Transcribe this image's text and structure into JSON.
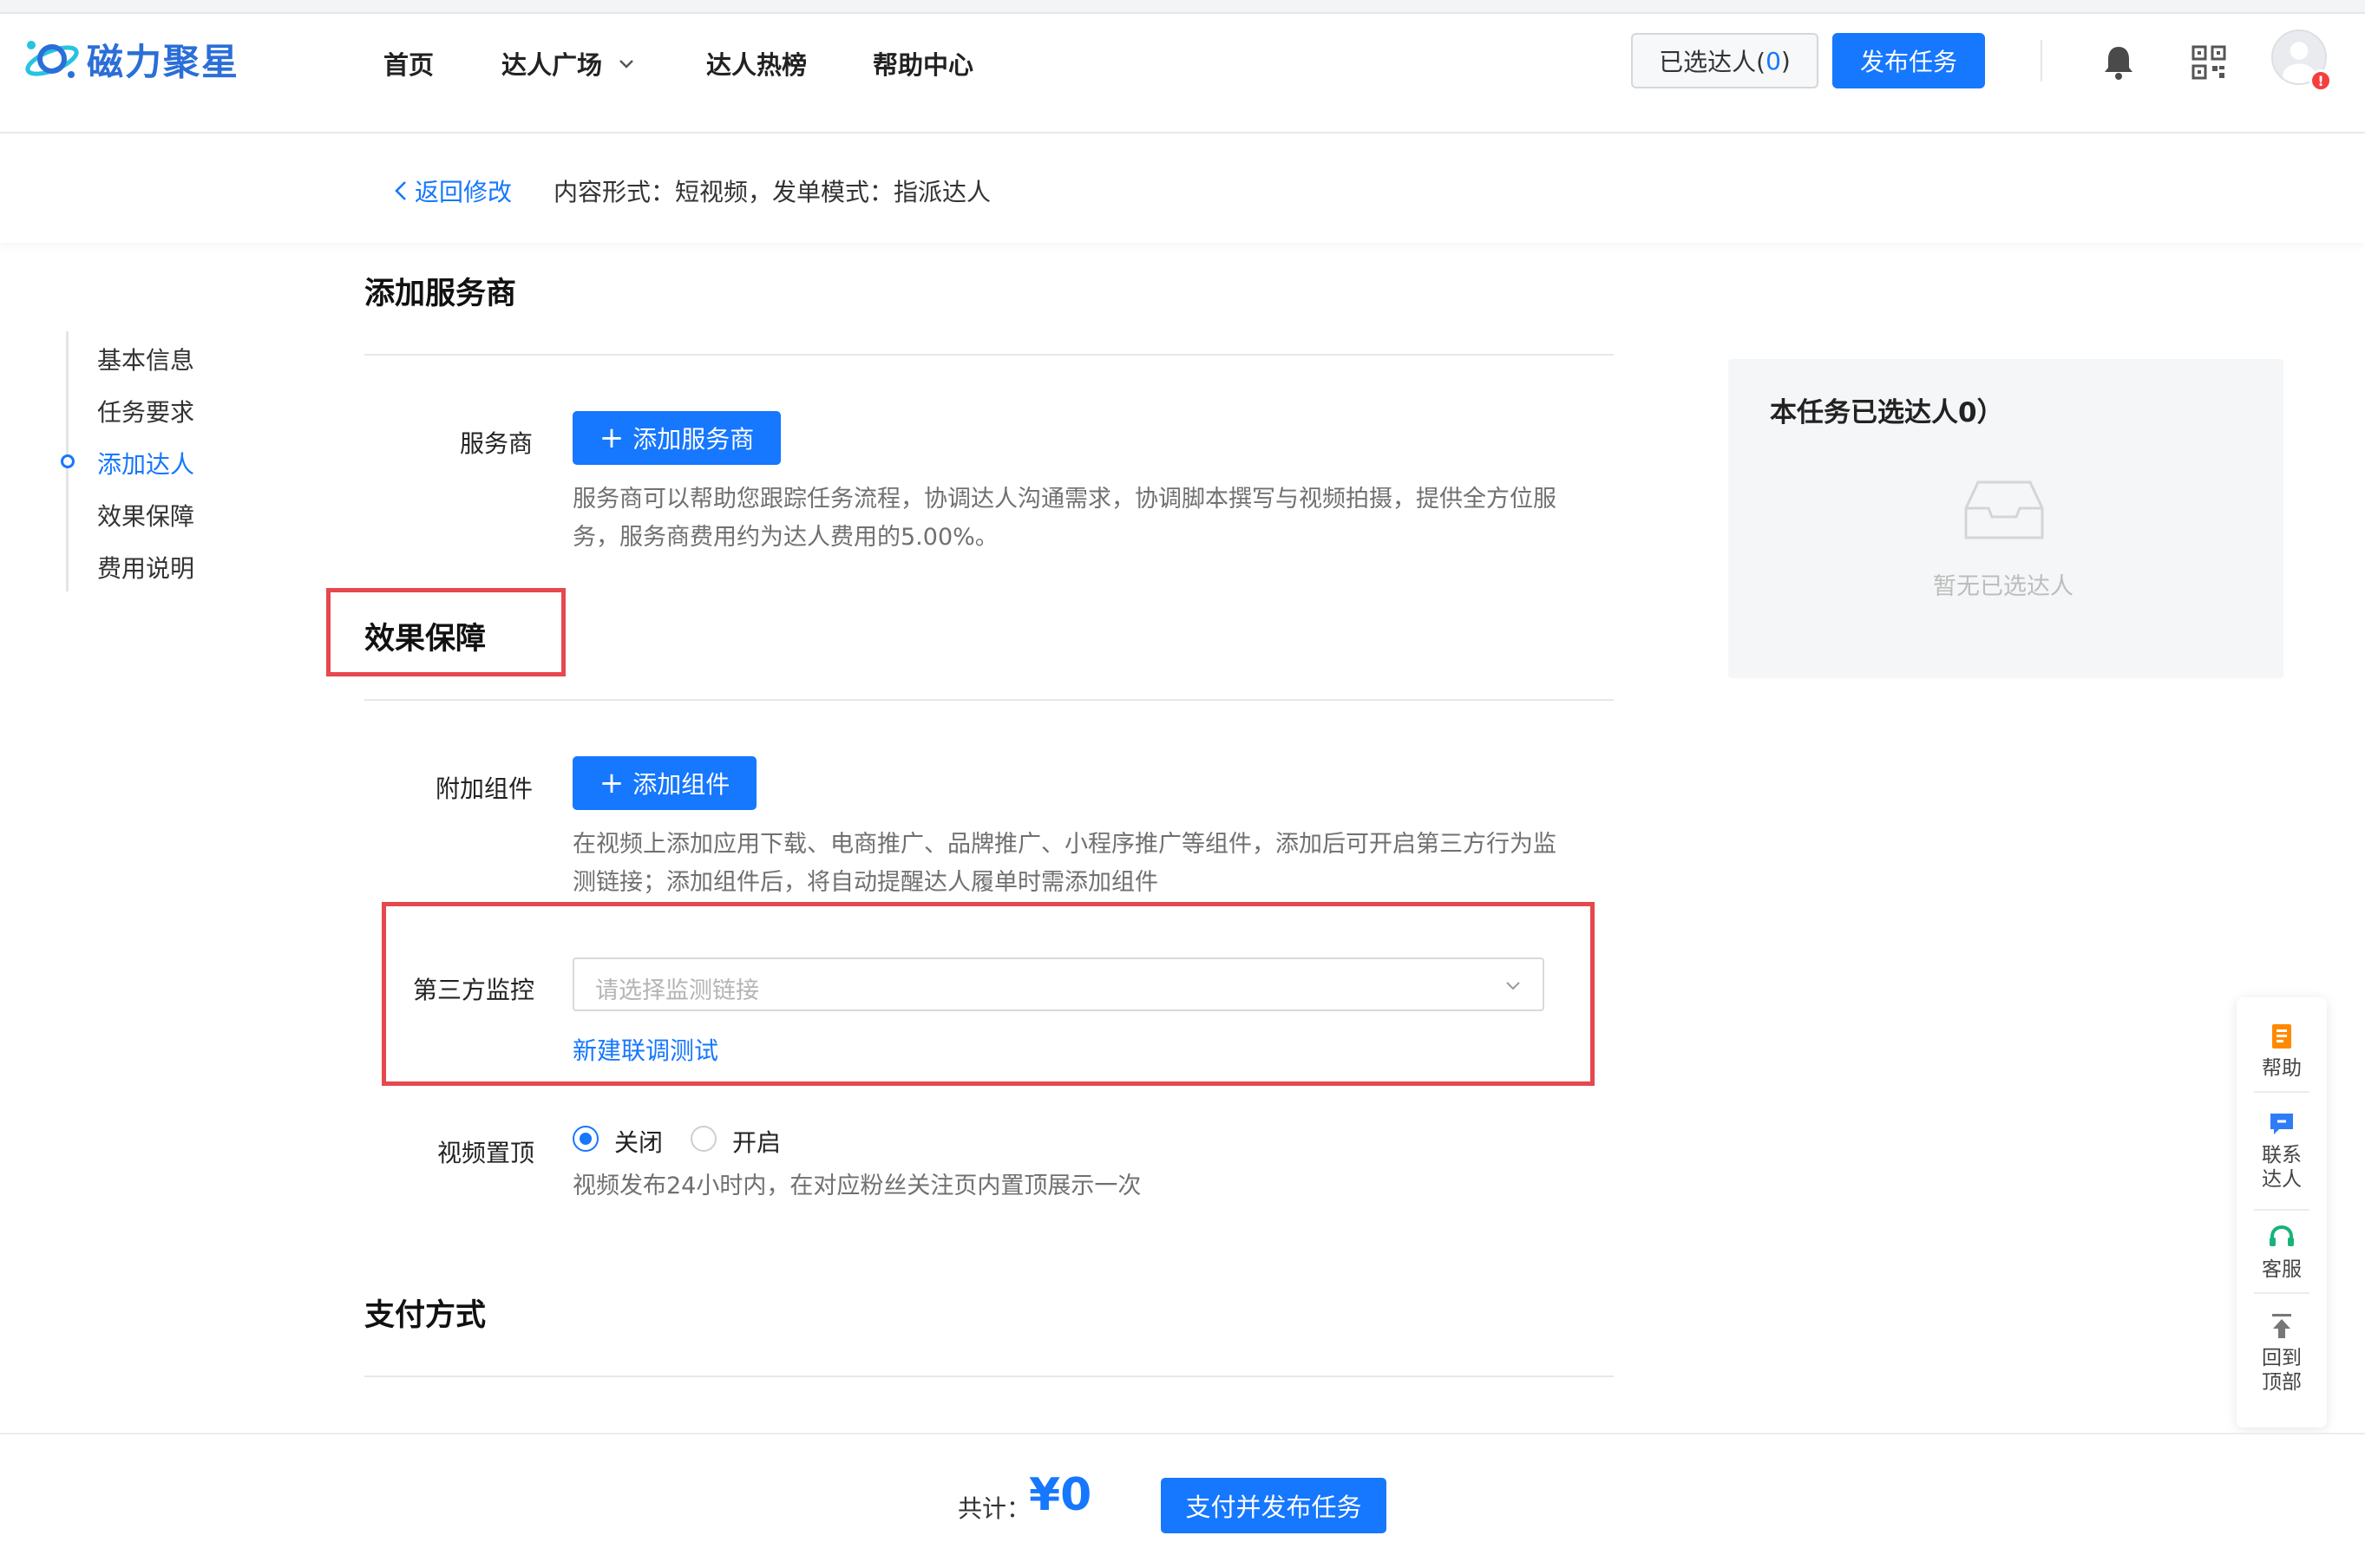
{
  "header": {
    "logo_text": "磁力聚星",
    "nav": [
      {
        "label": "首页"
      },
      {
        "label": "达人广场"
      },
      {
        "label": "达人热榜"
      },
      {
        "label": "帮助中心"
      }
    ],
    "selected_prefix": "已选达人(",
    "selected_count": "0",
    "selected_suffix": ")",
    "publish_label": "发布任务"
  },
  "subbar": {
    "back_label": "返回修改",
    "content_info": "内容形式：短视频，发单模式：指派达人"
  },
  "sidebar": {
    "items": [
      {
        "label": "基本信息"
      },
      {
        "label": "任务要求"
      },
      {
        "label": "添加达人"
      },
      {
        "label": "效果保障"
      },
      {
        "label": "费用说明"
      }
    ],
    "active_index": 2
  },
  "main": {
    "section_service": {
      "title": "添加服务商",
      "label": "服务商",
      "button": "添加服务商",
      "description": "服务商可以帮助您跟踪任务流程，协调达人沟通需求，协调脚本撰写与视频拍摄，提供全方位服务，服务商费用约为达人费用的5.00%。"
    },
    "section_effect": {
      "title": "效果保障",
      "component_label": "附加组件",
      "component_button": "添加组件",
      "component_description": "在视频上添加应用下载、电商推广、品牌推广、小程序推广等组件，添加后可开启第三方行为监测链接；添加组件后，将自动提醒达人履单时需添加组件",
      "monitor_label": "第三方监控",
      "monitor_placeholder": "请选择监测链接",
      "monitor_link": "新建联调测试",
      "pin_label": "视频置顶",
      "pin_options": [
        {
          "label": "关闭",
          "selected": true
        },
        {
          "label": "开启",
          "selected": false
        }
      ],
      "pin_description": "视频发布24小时内，在对应粉丝关注页内置顶展示一次"
    },
    "section_payment": {
      "title": "支付方式"
    }
  },
  "panel": {
    "title": "本任务已选达人0）",
    "empty_text": "暂无已选达人"
  },
  "float_bar": {
    "items": [
      {
        "label": "帮助",
        "icon": "help-doc-icon"
      },
      {
        "label": "联系达人",
        "icon": "chat-icon"
      },
      {
        "label": "客服",
        "icon": "headset-icon"
      },
      {
        "label": "回到顶部",
        "icon": "back-to-top-icon"
      }
    ]
  },
  "footer": {
    "total_label": "共计：",
    "total_value": "¥0",
    "pay_button": "支付并发布任务"
  },
  "colors": {
    "primary": "#1677ff",
    "annotation_red": "#e5484d",
    "panel_bg": "#f5f6f8"
  }
}
